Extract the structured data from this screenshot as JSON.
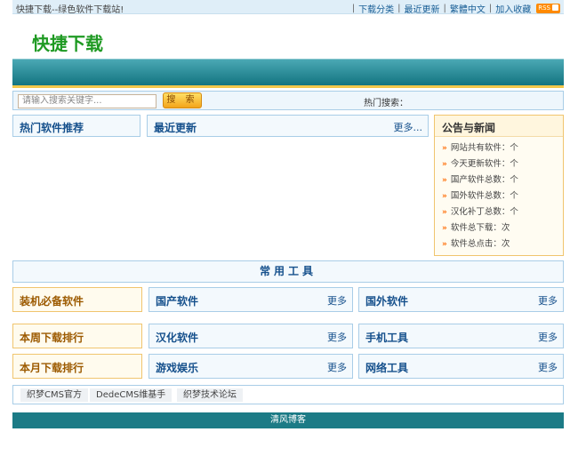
{
  "topbar": {
    "welcome": "快捷下载--绿色软件下载站!",
    "links": [
      "下载分类",
      "最近更新",
      "繁體中文",
      "加入收藏"
    ],
    "rss_label": "RSS"
  },
  "logo": "快捷下载",
  "search": {
    "placeholder": "请输入搜索关键字...",
    "button": "搜 索",
    "hot_label": "热门搜索："
  },
  "sections": {
    "hot_software": "热门软件推荐",
    "latest": "最近更新",
    "latest_more": "更多...",
    "notice_title": "公告与新闻"
  },
  "stats": [
    "网站共有软件：个",
    "今天更新软件：个",
    "国产软件总数：个",
    "国外软件总数：个",
    "汉化补丁总数：个",
    "软件总下载：次",
    "软件总点击：次"
  ],
  "tools_title": "常用工具",
  "categories": {
    "must_have": "装机必备软件",
    "weekly_rank": "本周下载排行",
    "monthly_rank": "本月下载排行",
    "domestic": "国产软件",
    "foreign": "国外软件",
    "chinese": "汉化软件",
    "mobile": "手机工具",
    "games": "游戏娱乐",
    "network": "网络工具",
    "more": "更多"
  },
  "friend_links": [
    "织梦CMS官方",
    "DedeCMS维基手",
    "织梦技术论坛"
  ],
  "footer": "清风博客",
  "colors": {
    "accent": "#1c7b86",
    "logo": "#1f9a23",
    "title_blue": "#15508c",
    "highlight": "#f2c74a"
  }
}
